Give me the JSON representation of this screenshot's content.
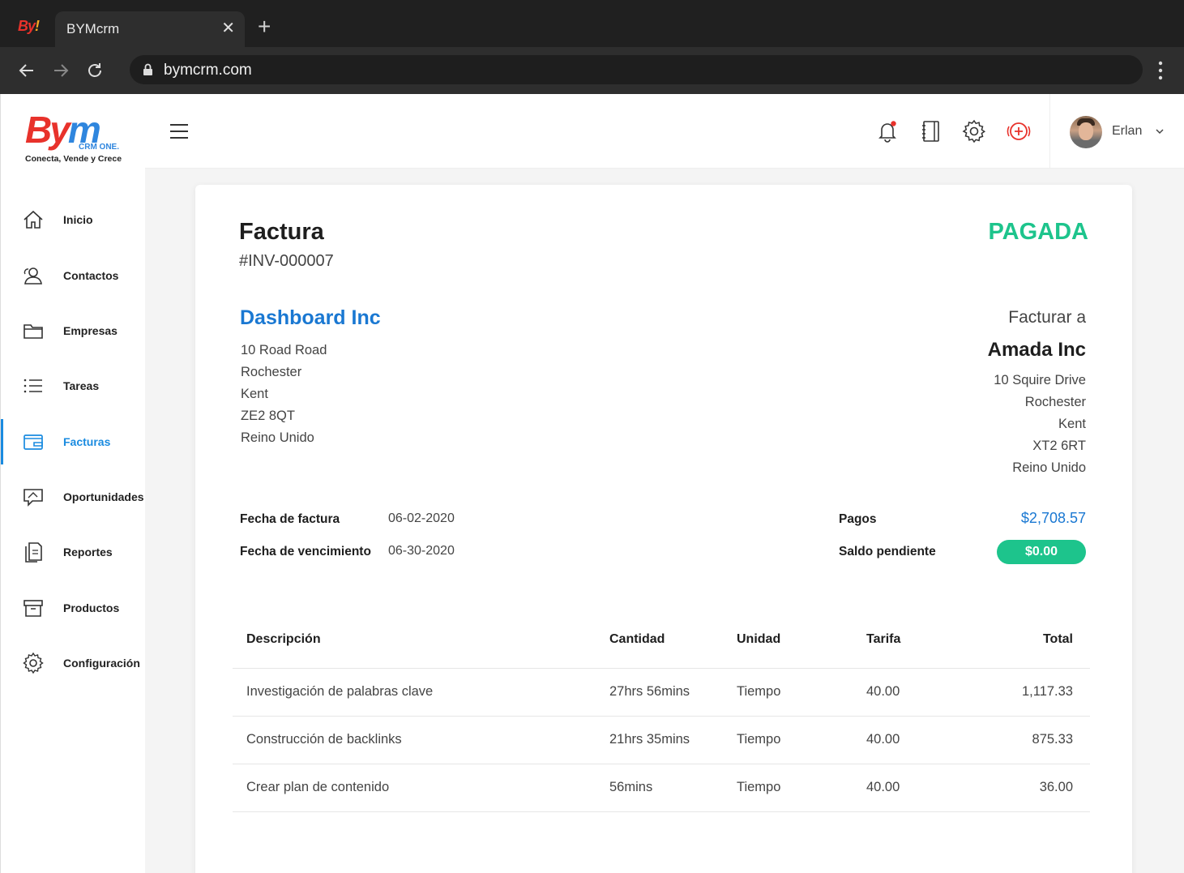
{
  "browser": {
    "tab_title": "BYMcrm",
    "url": "bymcrm.com",
    "favicon_text": "By",
    "favicon_sub": "!"
  },
  "brand": {
    "logo_text_a": "By",
    "logo_text_b": "m",
    "logo_sub": "CRM ONE.",
    "tagline": "Conecta, Vende y Crece"
  },
  "sidebar": {
    "items": [
      {
        "label": "Inicio",
        "icon": "home-icon"
      },
      {
        "label": "Contactos",
        "icon": "contacts-icon"
      },
      {
        "label": "Empresas",
        "icon": "folder-icon"
      },
      {
        "label": "Tareas",
        "icon": "list-icon"
      },
      {
        "label": "Facturas",
        "icon": "invoice-icon",
        "active": true
      },
      {
        "label": "Oportunidades",
        "icon": "chat-icon"
      },
      {
        "label": "Reportes",
        "icon": "reports-icon"
      },
      {
        "label": "Productos",
        "icon": "archive-icon"
      },
      {
        "label": "Configuración",
        "icon": "gear-icon"
      }
    ]
  },
  "topbar": {
    "user_name": "Erlan"
  },
  "invoice": {
    "title": "Factura",
    "number": "#INV-000007",
    "status": "PAGADA",
    "from": {
      "name": "Dashboard Inc",
      "address": [
        "10 Road Road",
        "Rochester",
        "Kent",
        "ZE2 8QT",
        "Reino Unido"
      ]
    },
    "bill_to": {
      "label": "Facturar a",
      "name": "Amada Inc",
      "address": [
        "10 Squire Drive",
        "Rochester",
        "Kent",
        "XT2 6RT",
        "Reino Unido"
      ]
    },
    "meta": {
      "invoice_date_label": "Fecha de factura",
      "invoice_date": "06-02-2020",
      "due_date_label": "Fecha de vencimiento",
      "due_date": "06-30-2020",
      "payments_label": "Pagos",
      "payments": "$2,708.57",
      "balance_label": "Saldo pendiente",
      "balance": "$0.00"
    },
    "columns": [
      "Descripción",
      "Cantidad",
      "Unidad",
      "Tarifa",
      "Total"
    ],
    "rows": [
      [
        "Investigación de palabras clave",
        "27hrs 56mins",
        "Tiempo",
        "40.00",
        "1,117.33"
      ],
      [
        "Construcción de backlinks",
        "21hrs 35mins",
        "Tiempo",
        "40.00",
        "875.33"
      ],
      [
        "Crear plan de contenido",
        "56mins",
        "Tiempo",
        "40.00",
        "36.00"
      ]
    ]
  },
  "colors": {
    "accent": "#1a8be0",
    "paid": "#1dc48c",
    "logo_red": "#e8322b",
    "logo_blue": "#2f86de"
  }
}
